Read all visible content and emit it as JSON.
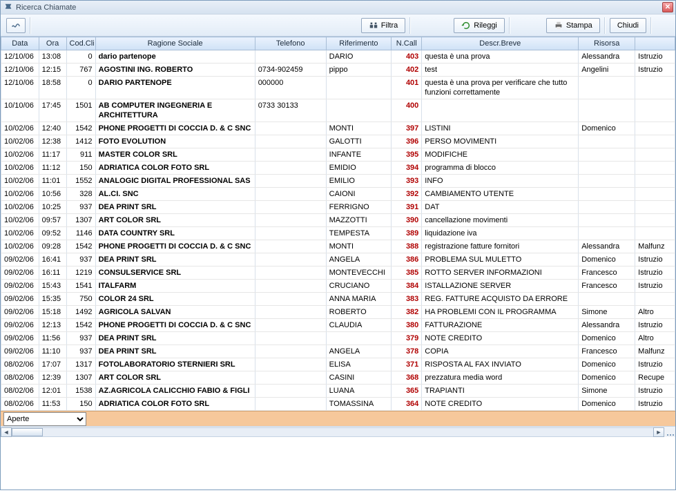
{
  "window": {
    "title": "Ricerca Chiamate"
  },
  "toolbar": {
    "filter_label": "Filtra",
    "reload_label": "Rileggi",
    "print_label": "Stampa",
    "close_label": "Chiudi"
  },
  "columns": {
    "data": "Data",
    "ora": "Ora",
    "codcli": "Cod.Cli",
    "ragione": "Ragione Sociale",
    "telefono": "Telefono",
    "riferimento": "Riferimento",
    "ncall": "N.Call",
    "descr": "Descr.Breve",
    "risorsa": "Risorsa",
    "extra": ""
  },
  "footer": {
    "filter_select": "Aperte"
  },
  "rows": [
    {
      "data": "12/10/06",
      "ora": "13:08",
      "cod": "0",
      "rag": "dario partenope",
      "tel": "",
      "rif": "DARIO",
      "n": "403",
      "descr": "questa è una prova",
      "ris": "Alessandra",
      "extra": "Istruzio"
    },
    {
      "data": "12/10/06",
      "ora": "12:15",
      "cod": "767",
      "rag": "AGOSTINI ING. ROBERTO",
      "tel": "0734-902459",
      "rif": "pippo",
      "n": "402",
      "descr": "test",
      "ris": "Angelini",
      "extra": "Istruzio"
    },
    {
      "data": "12/10/06",
      "ora": "18:58",
      "cod": "0",
      "rag": "DARIO PARTENOPE",
      "tel": "000000",
      "rif": "",
      "n": "401",
      "descr": "questa è una prova per verificare che tutto funzioni correttamente",
      "ris": "",
      "extra": ""
    },
    {
      "data": "10/10/06",
      "ora": "17:45",
      "cod": "1501",
      "rag": "AB COMPUTER INGEGNERIA E ARCHITETTURA",
      "tel": "0733 30133",
      "rif": "",
      "n": "400",
      "descr": "",
      "ris": "",
      "extra": ""
    },
    {
      "data": "10/02/06",
      "ora": "12:40",
      "cod": "1542",
      "rag": "PHONE PROGETTI DI COCCIA D. & C SNC",
      "tel": "",
      "rif": "MONTI",
      "n": "397",
      "descr": "LISTINI",
      "ris": "Domenico",
      "extra": ""
    },
    {
      "data": "10/02/06",
      "ora": "12:38",
      "cod": "1412",
      "rag": "FOTO EVOLUTION",
      "tel": "",
      "rif": "GALOTTI",
      "n": "396",
      "descr": "PERSO MOVIMENTI",
      "ris": "",
      "extra": ""
    },
    {
      "data": "10/02/06",
      "ora": "11:17",
      "cod": "911",
      "rag": "MASTER COLOR SRL",
      "tel": "",
      "rif": "INFANTE",
      "n": "395",
      "descr": "MODIFICHE",
      "ris": "",
      "extra": ""
    },
    {
      "data": "10/02/06",
      "ora": "11:12",
      "cod": "150",
      "rag": "ADRIATICA COLOR FOTO SRL",
      "tel": "",
      "rif": "EMIDIO",
      "n": "394",
      "descr": "programma di blocco",
      "ris": "",
      "extra": ""
    },
    {
      "data": "10/02/06",
      "ora": "11:01",
      "cod": "1552",
      "rag": "ANALOGIC DIGITAL PROFESSIONAL SAS",
      "tel": "",
      "rif": "EMILIO",
      "n": "393",
      "descr": "INFO",
      "ris": "",
      "extra": ""
    },
    {
      "data": "10/02/06",
      "ora": "10:56",
      "cod": "328",
      "rag": "AL.CI. SNC",
      "tel": "",
      "rif": "CAIONI",
      "n": "392",
      "descr": "CAMBIAMENTO UTENTE",
      "ris": "",
      "extra": ""
    },
    {
      "data": "10/02/06",
      "ora": "10:25",
      "cod": "937",
      "rag": "DEA PRINT SRL",
      "tel": "",
      "rif": "FERRIGNO",
      "n": "391",
      "descr": "DAT",
      "ris": "",
      "extra": ""
    },
    {
      "data": "10/02/06",
      "ora": "09:57",
      "cod": "1307",
      "rag": "ART COLOR SRL",
      "tel": "",
      "rif": "MAZZOTTI",
      "n": "390",
      "descr": "cancellazione movimenti",
      "ris": "",
      "extra": ""
    },
    {
      "data": "10/02/06",
      "ora": "09:52",
      "cod": "1146",
      "rag": "DATA COUNTRY SRL",
      "tel": "",
      "rif": "TEMPESTA",
      "n": "389",
      "descr": "liquidazione iva",
      "ris": "",
      "extra": ""
    },
    {
      "data": "10/02/06",
      "ora": "09:28",
      "cod": "1542",
      "rag": "PHONE PROGETTI DI COCCIA D. & C SNC",
      "tel": "",
      "rif": "MONTI",
      "n": "388",
      "descr": "registrazione fatture fornitori",
      "ris": "Alessandra",
      "extra": "Malfunz"
    },
    {
      "data": "09/02/06",
      "ora": "16:41",
      "cod": "937",
      "rag": "DEA PRINT SRL",
      "tel": "",
      "rif": "ANGELA",
      "n": "386",
      "descr": "PROBLEMA SUL MULETTO",
      "ris": "Domenico",
      "extra": "Istruzio"
    },
    {
      "data": "09/02/06",
      "ora": "16:11",
      "cod": "1219",
      "rag": "CONSULSERVICE SRL",
      "tel": "",
      "rif": "MONTEVECCHI",
      "n": "385",
      "descr": "ROTTO SERVER INFORMAZIONI",
      "ris": "Francesco",
      "extra": "Istruzio"
    },
    {
      "data": "09/02/06",
      "ora": "15:43",
      "cod": "1541",
      "rag": "ITALFARM",
      "tel": "",
      "rif": "CRUCIANO",
      "n": "384",
      "descr": "ISTALLAZIONE SERVER",
      "ris": "Francesco",
      "extra": "Istruzio"
    },
    {
      "data": "09/02/06",
      "ora": "15:35",
      "cod": "750",
      "rag": "COLOR 24 SRL",
      "tel": "",
      "rif": "ANNA MARIA",
      "n": "383",
      "descr": "REG. FATTURE ACQUISTO DA ERRORE",
      "ris": "",
      "extra": ""
    },
    {
      "data": "09/02/06",
      "ora": "15:18",
      "cod": "1492",
      "rag": "AGRICOLA SALVAN",
      "tel": "",
      "rif": "ROBERTO",
      "n": "382",
      "descr": "HA PROBLEMI CON IL PROGRAMMA",
      "ris": "Simone",
      "extra": "Altro"
    },
    {
      "data": "09/02/06",
      "ora": "12:13",
      "cod": "1542",
      "rag": "PHONE PROGETTI DI COCCIA D. & C SNC",
      "tel": "",
      "rif": "CLAUDIA",
      "n": "380",
      "descr": "FATTURAZIONE",
      "ris": "Alessandra",
      "extra": "Istruzio"
    },
    {
      "data": "09/02/06",
      "ora": "11:56",
      "cod": "937",
      "rag": "DEA PRINT SRL",
      "tel": "",
      "rif": "",
      "n": "379",
      "descr": "NOTE CREDITO",
      "ris": "Domenico",
      "extra": "Altro"
    },
    {
      "data": "09/02/06",
      "ora": "11:10",
      "cod": "937",
      "rag": "DEA PRINT SRL",
      "tel": "",
      "rif": "ANGELA",
      "n": "378",
      "descr": "COPIA",
      "ris": "Francesco",
      "extra": "Malfunz"
    },
    {
      "data": "08/02/06",
      "ora": "17:07",
      "cod": "1317",
      "rag": "FOTOLABORATORIO STERNIERI SRL",
      "tel": "",
      "rif": "ELISA",
      "n": "371",
      "descr": "RISPOSTA AL FAX INVIATO",
      "ris": "Domenico",
      "extra": "Istruzio"
    },
    {
      "data": "08/02/06",
      "ora": "12:39",
      "cod": "1307",
      "rag": "ART COLOR SRL",
      "tel": "",
      "rif": "CASINI",
      "n": "368",
      "descr": "prezzatura media word",
      "ris": "Domenico",
      "extra": "Recupe"
    },
    {
      "data": "08/02/06",
      "ora": "12:01",
      "cod": "1538",
      "rag": "AZ.AGRICOLA CALICCHIO FABIO & FIGLI",
      "tel": "",
      "rif": "LUANA",
      "n": "365",
      "descr": "TRAPIANTI",
      "ris": "Simone",
      "extra": "Istruzio"
    },
    {
      "data": "08/02/06",
      "ora": "11:53",
      "cod": "150",
      "rag": "ADRIATICA COLOR FOTO SRL",
      "tel": "",
      "rif": "TOMASSINA",
      "n": "364",
      "descr": "NOTE CREDITO",
      "ris": "Domenico",
      "extra": "Istruzio"
    }
  ]
}
